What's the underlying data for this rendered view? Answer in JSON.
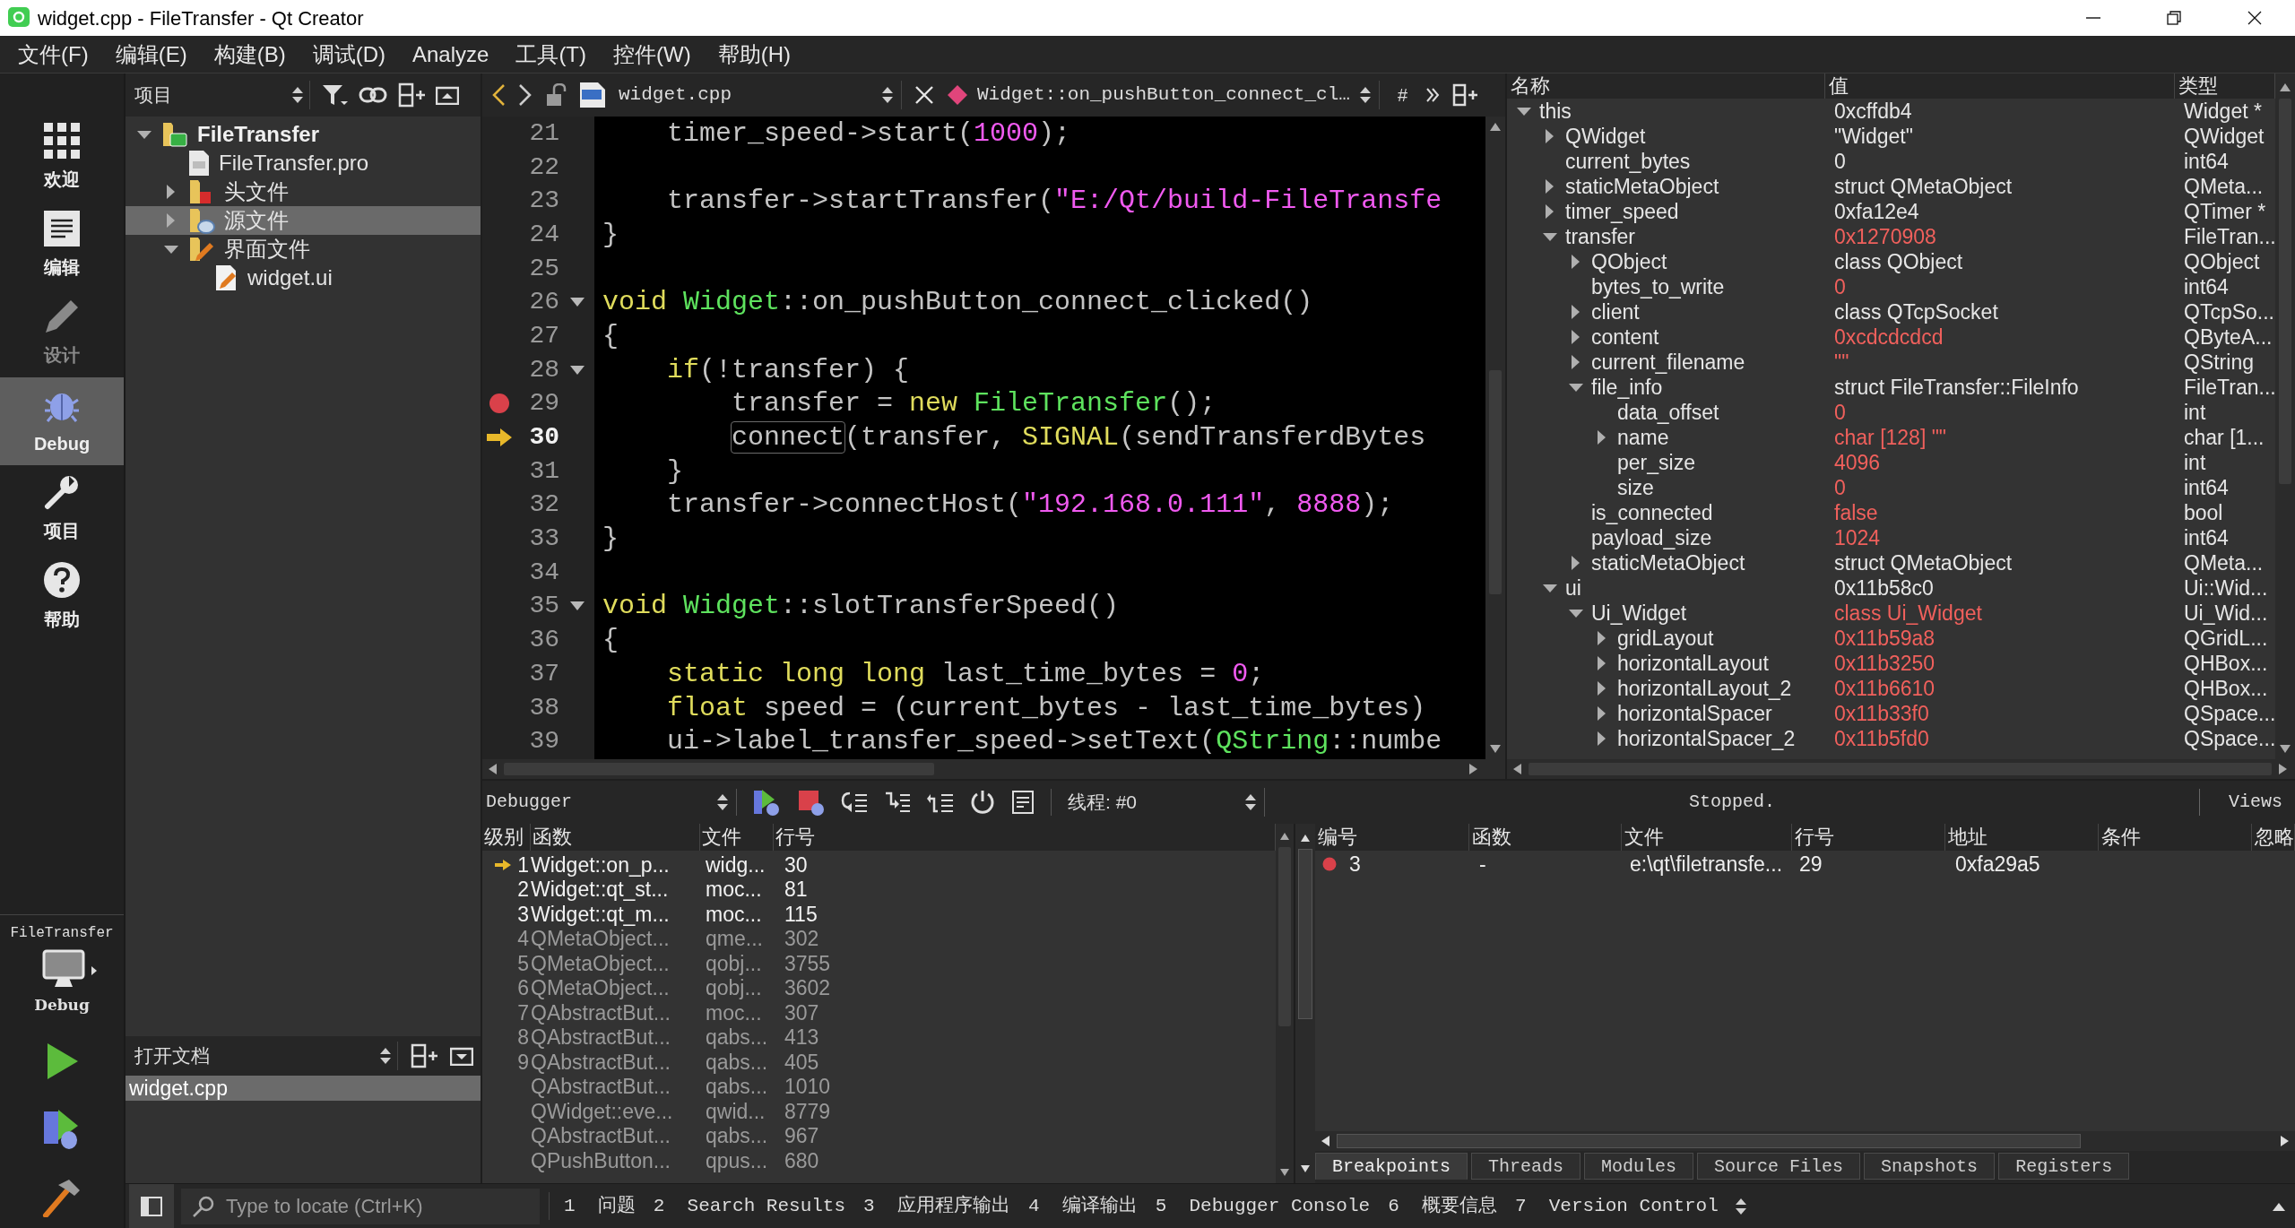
{
  "window": {
    "title": "widget.cpp - FileTransfer - Qt Creator"
  },
  "menu": [
    "文件(F)",
    "编辑(E)",
    "构建(B)",
    "调试(D)",
    "Analyze",
    "工具(T)",
    "控件(W)",
    "帮助(H)"
  ],
  "mode_bar": {
    "items": [
      {
        "kind": "welcome",
        "label": "欢迎",
        "selected": false,
        "disabled": false
      },
      {
        "kind": "edit",
        "label": "编辑",
        "selected": false,
        "disabled": false
      },
      {
        "kind": "design",
        "label": "设计",
        "selected": false,
        "disabled": true
      },
      {
        "kind": "debug",
        "label": "Debug",
        "selected": true,
        "disabled": false
      },
      {
        "kind": "projects",
        "label": "项目",
        "selected": false,
        "disabled": false
      },
      {
        "kind": "help",
        "label": "帮助",
        "selected": false,
        "disabled": false
      }
    ],
    "kit": {
      "project": "FileTransfer",
      "config": "Debug"
    }
  },
  "project_panel": {
    "view": "项目",
    "tree": [
      {
        "label": "FileTransfer",
        "kind": "project",
        "expanded": true,
        "selected": false,
        "children": [
          {
            "label": "FileTransfer.pro",
            "kind": "pro",
            "selected": false
          },
          {
            "label": "头文件",
            "kind": "headers",
            "expanded": false,
            "selected": false
          },
          {
            "label": "源文件",
            "kind": "sources",
            "expanded": false,
            "selected": true
          },
          {
            "label": "界面文件",
            "kind": "forms",
            "expanded": true,
            "selected": false,
            "children": [
              {
                "label": "widget.ui",
                "kind": "ui",
                "selected": false
              }
            ]
          }
        ]
      }
    ]
  },
  "open_documents": {
    "title": "打开文档",
    "items": [
      {
        "label": "widget.cpp",
        "selected": true
      }
    ]
  },
  "editor": {
    "file": "widget.cpp",
    "symbol": "Widget::on_pushButton_connect_cl…",
    "hash_button": "#",
    "lines": [
      {
        "number": "21",
        "fold": false,
        "breakpoint": false,
        "current": false,
        "tokens": [
          {
            "t": "    timer_speed->start(",
            "kind": "plain"
          },
          {
            "t": "1000",
            "kind": "literal"
          },
          {
            "t": ");",
            "kind": "plain"
          }
        ]
      },
      {
        "number": "22",
        "fold": false,
        "breakpoint": false,
        "current": false
      },
      {
        "number": "23",
        "fold": false,
        "breakpoint": false,
        "current": false,
        "tokens": [
          {
            "t": "    transfer->startTransfer(",
            "kind": "plain"
          },
          {
            "t": "\"E:/Qt/build-FileTransfe",
            "kind": "literal"
          }
        ]
      },
      {
        "number": "24",
        "fold": false,
        "breakpoint": false,
        "current": false,
        "tokens": [
          {
            "t": "}",
            "kind": "plain"
          }
        ]
      },
      {
        "number": "25",
        "fold": false,
        "breakpoint": false,
        "current": false
      },
      {
        "number": "26",
        "fold": true,
        "breakpoint": false,
        "current": false,
        "tokens": [
          {
            "t": "void ",
            "kind": "keyword"
          },
          {
            "t": "Widget",
            "kind": "type"
          },
          {
            "t": "::on_pushButton_connect_clicked()",
            "kind": "plain"
          }
        ]
      },
      {
        "number": "27",
        "fold": false,
        "breakpoint": false,
        "current": false,
        "tokens": [
          {
            "t": "{",
            "kind": "plain"
          }
        ]
      },
      {
        "number": "28",
        "fold": true,
        "breakpoint": false,
        "current": false,
        "tokens": [
          {
            "t": "    if",
            "kind": "keyword"
          },
          {
            "t": "(!transfer) {",
            "kind": "plain"
          }
        ]
      },
      {
        "number": "29",
        "fold": false,
        "breakpoint": true,
        "current": false,
        "tokens": [
          {
            "t": "        transfer = ",
            "kind": "plain"
          },
          {
            "t": "new ",
            "kind": "keyword"
          },
          {
            "t": "FileTransfer",
            "kind": "type"
          },
          {
            "t": "();",
            "kind": "plain"
          }
        ]
      },
      {
        "number": "30",
        "fold": false,
        "breakpoint": false,
        "current": true,
        "tokens": [
          {
            "t": "        connect",
            "kind": "usage"
          },
          {
            "t": "(transfer, ",
            "kind": "plain"
          },
          {
            "t": "SIGNAL",
            "kind": "keyword"
          },
          {
            "t": "(sendTransferdBytes",
            "kind": "plain"
          }
        ]
      },
      {
        "number": "31",
        "fold": false,
        "breakpoint": false,
        "current": false,
        "tokens": [
          {
            "t": "    }",
            "kind": "plain"
          }
        ]
      },
      {
        "number": "32",
        "fold": false,
        "breakpoint": false,
        "current": false,
        "tokens": [
          {
            "t": "    transfer->connectHost(",
            "kind": "plain"
          },
          {
            "t": "\"192.168.0.111\"",
            "kind": "literal"
          },
          {
            "t": ", ",
            "kind": "plain"
          },
          {
            "t": "8888",
            "kind": "literal"
          },
          {
            "t": ");",
            "kind": "plain"
          }
        ]
      },
      {
        "number": "33",
        "fold": false,
        "breakpoint": false,
        "current": false,
        "tokens": [
          {
            "t": "}",
            "kind": "plain"
          }
        ]
      },
      {
        "number": "34",
        "fold": false,
        "breakpoint": false,
        "current": false
      },
      {
        "number": "35",
        "fold": true,
        "breakpoint": false,
        "current": false,
        "tokens": [
          {
            "t": "void ",
            "kind": "keyword"
          },
          {
            "t": "Widget",
            "kind": "type"
          },
          {
            "t": "::slotTransferSpeed()",
            "kind": "plain"
          }
        ]
      },
      {
        "number": "36",
        "fold": false,
        "breakpoint": false,
        "current": false,
        "tokens": [
          {
            "t": "{",
            "kind": "plain"
          }
        ]
      },
      {
        "number": "37",
        "fold": false,
        "breakpoint": false,
        "current": false,
        "tokens": [
          {
            "t": "    static long long",
            "kind": "keyword"
          },
          {
            "t": " last_time_bytes = ",
            "kind": "plain"
          },
          {
            "t": "0",
            "kind": "literal"
          },
          {
            "t": ";",
            "kind": "plain"
          }
        ]
      },
      {
        "number": "38",
        "fold": false,
        "breakpoint": false,
        "current": false,
        "tokens": [
          {
            "t": "    float",
            "kind": "keyword"
          },
          {
            "t": " speed = (current_bytes - last_time_bytes)",
            "kind": "plain"
          }
        ]
      },
      {
        "number": "39",
        "fold": false,
        "breakpoint": false,
        "current": false,
        "tokens": [
          {
            "t": "    ui->label_transfer_speed->setText(",
            "kind": "plain"
          },
          {
            "t": "QString",
            "kind": "type"
          },
          {
            "t": "::numbe",
            "kind": "plain"
          }
        ]
      }
    ]
  },
  "locals": {
    "columns": [
      "名称",
      "值",
      "类型"
    ],
    "rows": [
      {
        "name": "this",
        "value": "0xcffdb4",
        "type": "Widget *",
        "expanded": true,
        "changed": false,
        "children": [
          {
            "name": "QWidget",
            "value": "\"Widget\"",
            "type": "QWidget",
            "expanded": false,
            "changed": false
          },
          {
            "name": "current_bytes",
            "value": "0",
            "type": "int64",
            "changed": false
          },
          {
            "name": "staticMetaObject",
            "value": "struct QMetaObject",
            "type": "QMeta...",
            "expanded": false,
            "changed": false
          },
          {
            "name": "timer_speed",
            "value": "0xfa12e4",
            "type": "QTimer *",
            "expanded": false,
            "changed": false
          },
          {
            "name": "transfer",
            "value": "0x1270908",
            "type": "FileTran...",
            "expanded": true,
            "changed": true,
            "children": [
              {
                "name": "QObject",
                "value": "class QObject",
                "type": "QObject",
                "expanded": false,
                "changed": false
              },
              {
                "name": "bytes_to_write",
                "value": "0",
                "type": "int64",
                "changed": true
              },
              {
                "name": "client",
                "value": "class QTcpSocket",
                "type": "QTcpSo...",
                "expanded": false,
                "changed": false
              },
              {
                "name": "content",
                "value": "0xcdcdcdcd",
                "type": "QByteA...",
                "expanded": false,
                "changed": true
              },
              {
                "name": "current_filename",
                "value": "\"\"",
                "type": "QString",
                "expanded": false,
                "changed": true
              },
              {
                "name": "file_info",
                "value": "struct FileTransfer::FileInfo",
                "type": "FileTran...",
                "expanded": true,
                "changed": false,
                "children": [
                  {
                    "name": "data_offset",
                    "value": "0",
                    "type": "int",
                    "changed": true
                  },
                  {
                    "name": "name",
                    "value": "char [128] \"\"",
                    "type": "char [1...",
                    "expanded": false,
                    "changed": true
                  },
                  {
                    "name": "per_size",
                    "value": "4096",
                    "type": "int",
                    "changed": true
                  },
                  {
                    "name": "size",
                    "value": "0",
                    "type": "int64",
                    "changed": true
                  }
                ]
              },
              {
                "name": "is_connected",
                "value": "false",
                "type": "bool",
                "changed": true
              },
              {
                "name": "payload_size",
                "value": "1024",
                "type": "int64",
                "changed": true
              },
              {
                "name": "staticMetaObject",
                "value": "struct QMetaObject",
                "type": "QMeta...",
                "expanded": false,
                "changed": false
              }
            ]
          },
          {
            "name": "ui",
            "value": "0x11b58c0",
            "type": "Ui::Wid...",
            "expanded": true,
            "changed": false,
            "children": [
              {
                "name": "Ui_Widget",
                "value": "class Ui_Widget",
                "type": "Ui_Wid...",
                "expanded": true,
                "changed": true,
                "children": [
                  {
                    "name": "gridLayout",
                    "value": "0x11b59a8",
                    "type": "QGridL...",
                    "expanded": false,
                    "changed": true
                  },
                  {
                    "name": "horizontalLayout",
                    "value": "0x11b3250",
                    "type": "QHBox...",
                    "expanded": false,
                    "changed": true
                  },
                  {
                    "name": "horizontalLayout_2",
                    "value": "0x11b6610",
                    "type": "QHBox...",
                    "expanded": false,
                    "changed": true
                  },
                  {
                    "name": "horizontalSpacer",
                    "value": "0x11b33f0",
                    "type": "QSpace...",
                    "expanded": false,
                    "changed": true
                  },
                  {
                    "name": "horizontalSpacer_2",
                    "value": "0x11b5fd0",
                    "type": "QSpace...",
                    "expanded": false,
                    "changed": true
                  }
                ]
              }
            ]
          }
        ]
      }
    ]
  },
  "debugger": {
    "engine": "Debugger",
    "thread": "线程: #0",
    "status": "Stopped.",
    "views": "Views",
    "stack": {
      "columns": [
        "级别",
        "函数",
        "文件",
        "行号"
      ],
      "rows": [
        {
          "level": "1",
          "function": "Widget::on_p...",
          "file": "widg...",
          "line": "30",
          "current": true,
          "has_source": true
        },
        {
          "level": "2",
          "function": "Widget::qt_st...",
          "file": "moc...",
          "line": "81",
          "current": false,
          "has_source": true
        },
        {
          "level": "3",
          "function": "Widget::qt_m...",
          "file": "moc...",
          "line": "115",
          "current": false,
          "has_source": true
        },
        {
          "level": "4",
          "function": "QMetaObject...",
          "file": "qme...",
          "line": "302",
          "current": false,
          "has_source": false
        },
        {
          "level": "5",
          "function": "QMetaObject...",
          "file": "qobj...",
          "line": "3755",
          "current": false,
          "has_source": false
        },
        {
          "level": "6",
          "function": "QMetaObject...",
          "file": "qobj...",
          "line": "3602",
          "current": false,
          "has_source": false
        },
        {
          "level": "7",
          "function": "QAbstractBut...",
          "file": "moc...",
          "line": "307",
          "current": false,
          "has_source": false
        },
        {
          "level": "8",
          "function": "QAbstractBut...",
          "file": "qabs...",
          "line": "413",
          "current": false,
          "has_source": false
        },
        {
          "level": "9",
          "function": "QAbstractBut...",
          "file": "qabs...",
          "line": "405",
          "current": false,
          "has_source": false
        },
        {
          "function": "QAbstractBut...",
          "file": "qabs...",
          "line": "1010",
          "current": false,
          "has_source": false
        },
        {
          "function": "QWidget::eve...",
          "file": "qwid...",
          "line": "8779",
          "current": false,
          "has_source": false
        },
        {
          "function": "QAbstractBut...",
          "file": "qabs...",
          "line": "967",
          "current": false,
          "has_source": false
        },
        {
          "function": "QPushButton...",
          "file": "qpus...",
          "line": "680",
          "current": false,
          "has_source": false
        }
      ]
    },
    "breakpoints": {
      "columns": [
        "编号",
        "函数",
        "文件",
        "行号",
        "地址",
        "条件",
        "忽略"
      ],
      "rows": [
        {
          "number": "3",
          "function": "-",
          "file": "e:\\qt\\filetransfe...",
          "line": "29",
          "address": "0xfa29a5",
          "enabled": true
        }
      ]
    },
    "tabs": [
      {
        "label": "Breakpoints",
        "selected": true
      },
      {
        "label": "Threads",
        "selected": false
      },
      {
        "label": "Modules",
        "selected": false
      },
      {
        "label": "Source Files",
        "selected": false
      },
      {
        "label": "Snapshots",
        "selected": false
      },
      {
        "label": "Registers",
        "selected": false
      }
    ]
  },
  "status_bar": {
    "locator_placeholder": "Type to locate (Ctrl+K)",
    "panes": [
      "1  问题",
      "2  Search Results",
      "3  应用程序输出",
      "4  编译输出",
      "5  Debugger Console",
      "6  概要信息",
      "7  Version Control"
    ]
  }
}
